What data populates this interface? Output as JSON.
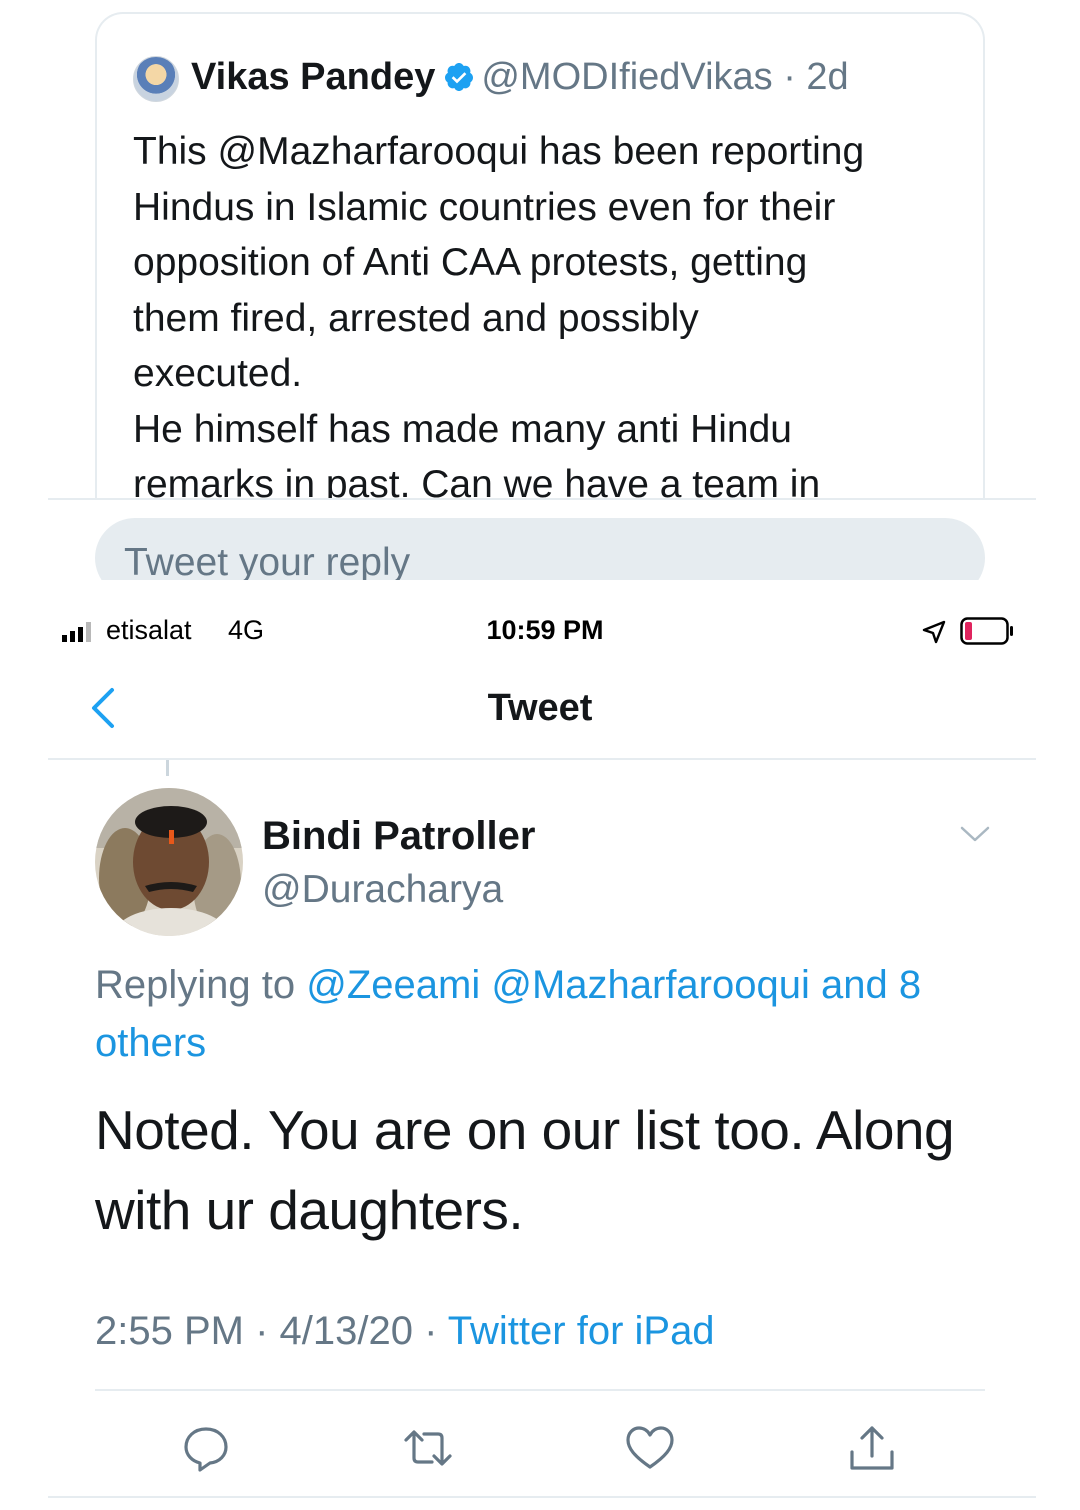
{
  "quoted_tweet": {
    "name": "Vikas Pandey",
    "handle_time": "@MODIfiedVikas · 2d",
    "text": "This @Mazharfarooqui has been reporting\nHindus in Islamic countries even for their\nopposition of Anti CAA protests, getting\nthem fired, arrested and possibly\nexecuted.\nHe himself has made many anti Hindu\nremarks in past. Can we have a team in",
    "reply_placeholder": "Tweet your reply"
  },
  "status_bar": {
    "carrier": "etisalat",
    "network": "4G",
    "time": "10:59 PM"
  },
  "nav": {
    "title": "Tweet"
  },
  "tweet": {
    "author_name": "Bindi Patroller",
    "author_handle": "@Duracharya",
    "replying_prefix": "Replying to ",
    "replying_targets": "@Zeeami @Mazharfarooqui and 8 others",
    "text": "Noted. You are on our list too. Along with ur daughters.",
    "time": "2:55 PM · 4/13/20 · ",
    "source": "Twitter for iPad"
  },
  "colors": {
    "link": "#1b95e0",
    "secondary_text": "#657786",
    "divider": "#e6ecf0",
    "battery_low": "#e0245e"
  },
  "icons": {
    "verified": "verified-badge-icon",
    "back": "chevron-left-icon",
    "menu": "chevron-down-icon",
    "reply": "comment-icon",
    "retweet": "retweet-icon",
    "like": "heart-icon",
    "share": "share-icon"
  }
}
